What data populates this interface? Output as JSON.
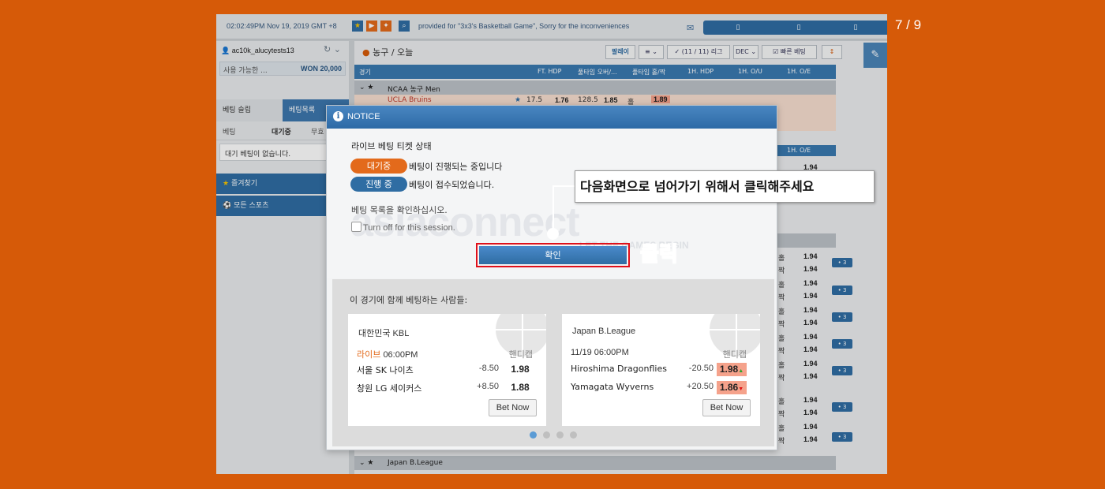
{
  "page_counter": "7 / 9",
  "topbar": {
    "clock": "02:02:49PM Nov 19, 2019 GMT +8",
    "ticker": "provided for \"3x3's Basketball Game\", Sorry for the inconveniences"
  },
  "sidebar": {
    "username": "ac10k_alucytests13",
    "balance_label": "사용 가능한 ...",
    "balance_value": "WON 20,000",
    "tab_betslip": "베팅 슬립",
    "tab_betlist": "베팅목록",
    "subtab_bet": "베팅",
    "subtab_waiting": "대기중",
    "subtab_more": "무효",
    "empty_msg": "대기 베팅이 없습니다.",
    "favorites": "즐겨찾기",
    "all_sports": "모든 스포츠"
  },
  "content": {
    "title": "농구 / 오늘",
    "btn_parlay": "팔레이",
    "btn_league": "(11 / 11) 리그",
    "btn_quick": "빠른 베팅",
    "col_game": "경기",
    "col_ft_hdp": "FT. HDP",
    "col_ft_ou": "풀타임 오버/...",
    "col_ft_oe": "풀타임 홀/짝",
    "col_1h_hdp": "1H. HDP",
    "col_1h_ou": "1H. O/U",
    "col_1h_oe": "1H. O/E",
    "group_ncaa": "NCAA 농구 Men",
    "ucla_team": "UCLA Bruins",
    "ucla_hdp": "17.5",
    "ucla_hdp_price": "1.76",
    "ucla_ou": "128.5",
    "ucla_ou_price": "1.85",
    "ucla_oe_label": "홀",
    "ucla_oe_price": "1.89",
    "group_japan": "Japan B.League",
    "row_odds": "1.94",
    "row_odd": "홀",
    "row_even": "짝",
    "more_label": "• 3"
  },
  "dialog": {
    "header": "NOTICE",
    "status_title": "라이브 베팅 티켓 상태",
    "pill_waiting": "대기중",
    "pill_waiting_desc": "베팅이 진행되는 중입니다",
    "pill_running": "진행 중",
    "pill_running_desc": "베팅이 접수되었습니다.",
    "check_msg": "베팅 목록을 확인하십시오.",
    "turn_off": "Turn off for this session.",
    "confirm": "확인",
    "watermark": "asiaconnect",
    "watermark_sub": "LET THE GAMES BEGIN",
    "lower_title": "이 경기에 함께 베팅하는 사람들:",
    "cards": [
      {
        "league": "대한민국 KBL",
        "live": "라이브",
        "time": "06:00PM",
        "hdp_label": "핸디캡",
        "team1": "서울 SK 나이츠",
        "team1_line": "-8.50",
        "team1_price": "1.98",
        "team2": "창원 LG 세이커스",
        "team2_line": "+8.50",
        "team2_price": "1.88",
        "bet_now": "Bet Now"
      },
      {
        "league": "Japan B.League",
        "time": "11/19 06:00PM",
        "hdp_label": "핸디캡",
        "team1": "Hiroshima Dragonflies",
        "team1_line": "-20.50",
        "team1_price": "1.98",
        "team2": "Yamagata Wyverns",
        "team2_line": "+20.50",
        "team2_price": "1.86",
        "bet_now": "Bet Now"
      }
    ]
  },
  "annotations": {
    "callout": "다음화면으로 넘어가기 위해서 클릭해주세요",
    "click_label": "클릭"
  },
  "colors": {
    "background": "#d65a08",
    "primary_blue": "#2f6da3",
    "orange_pill": "#e36a1b",
    "highlight_red": "#e0101a",
    "price_highlight": "#f5a28b"
  }
}
